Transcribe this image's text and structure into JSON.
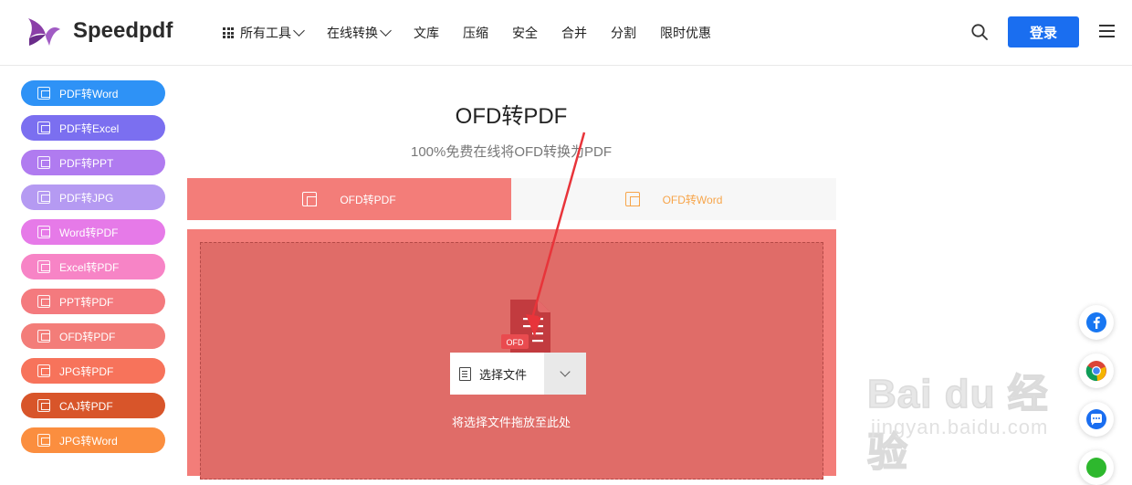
{
  "brand": {
    "name": "Speedpdf"
  },
  "nav": {
    "items": [
      {
        "label": "所有工具",
        "has_grid": true,
        "has_chevron": true
      },
      {
        "label": "在线转换",
        "has_chevron": true
      },
      {
        "label": "文库"
      },
      {
        "label": "压缩"
      },
      {
        "label": "安全"
      },
      {
        "label": "合并"
      },
      {
        "label": "分割"
      },
      {
        "label": "限时优惠"
      }
    ],
    "login_label": "登录"
  },
  "sidebar": {
    "items": [
      {
        "label": "PDF转Word",
        "color": "#2e92f6"
      },
      {
        "label": "PDF转Excel",
        "color": "#7b6ff0"
      },
      {
        "label": "PDF转PPT",
        "color": "#b07bf0"
      },
      {
        "label": "PDF转JPG",
        "color": "#b59af2"
      },
      {
        "label": "Word转PDF",
        "color": "#e67ae8"
      },
      {
        "label": "Excel转PDF",
        "color": "#f784c6"
      },
      {
        "label": "PPT转PDF",
        "color": "#f47a7e"
      },
      {
        "label": "OFD转PDF",
        "color": "#f37d79"
      },
      {
        "label": "JPG转PDF",
        "color": "#f7735b"
      },
      {
        "label": "CAJ转PDF",
        "color": "#d8552a"
      },
      {
        "label": "JPG转Word",
        "color": "#fb8e3f"
      }
    ]
  },
  "main": {
    "title": "OFD转PDF",
    "subtitle": "100%免费在线将OFD转换为PDF",
    "tabs": [
      {
        "label": "OFD转PDF",
        "active": true
      },
      {
        "label": "OFD转Word",
        "active": false
      }
    ],
    "file_icon_label": "OFD",
    "select_label": "选择文件",
    "drop_hint": "将选择文件拖放至此处"
  },
  "colors": {
    "accent": "#1a6ef0",
    "upload_bg": "#f37d79",
    "dropzone_bg": "#e06c68",
    "arrow": "#e8343a"
  },
  "watermark": {
    "big": "Bai du 经验",
    "small": "jingyan.baidu.com"
  }
}
